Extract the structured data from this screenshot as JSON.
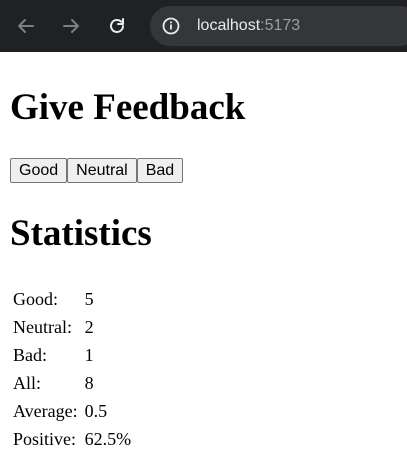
{
  "browser": {
    "url_host": "localhost",
    "url_port": ":5173"
  },
  "feedback": {
    "title": "Give Feedback",
    "buttons": [
      "Good",
      "Neutral",
      "Bad"
    ]
  },
  "statistics": {
    "title": "Statistics",
    "rows": [
      {
        "label": "Good:",
        "value": "5"
      },
      {
        "label": "Neutral:",
        "value": "2"
      },
      {
        "label": "Bad:",
        "value": "1"
      },
      {
        "label": "All:",
        "value": "8"
      },
      {
        "label": "Average:",
        "value": "0.5"
      },
      {
        "label": "Positive:",
        "value": "62.5%"
      }
    ]
  },
  "icons": {
    "back": "arrow-left-icon",
    "forward": "arrow-right-icon",
    "reload": "reload-icon",
    "info": "info-icon"
  }
}
